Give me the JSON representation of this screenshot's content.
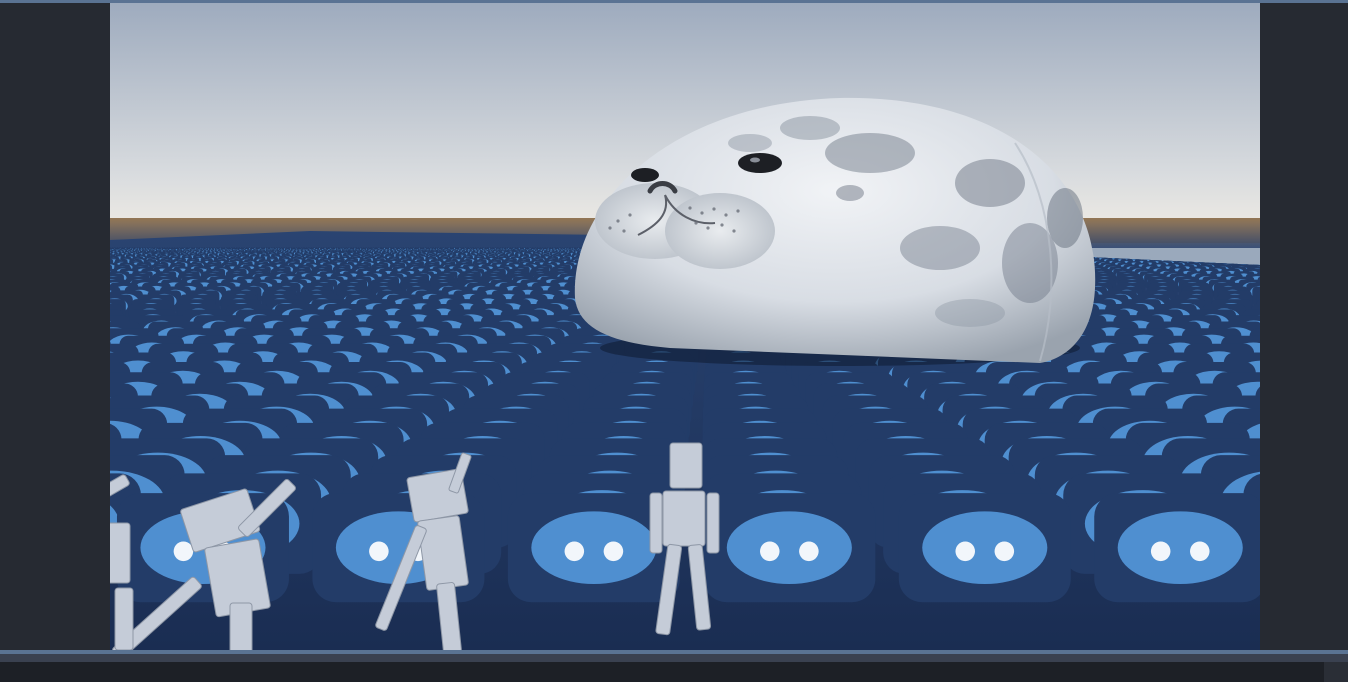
{
  "scene": {
    "sky_top": "#9eabbe",
    "sky_horizon": "#eceae6",
    "ground_horizon": "#7a5a38",
    "floor_tile": "#233c68",
    "floor_gap": "#16243f",
    "logo_color": "#4f8fd0",
    "mannequin_color": "#c5ccd8"
  },
  "objects": [
    {
      "name": "seal-plush",
      "kind": "plush seal model"
    },
    {
      "name": "godot-logo-floor",
      "kind": "tiled ground texture"
    },
    {
      "name": "mannequins",
      "kind": "humanoid figures",
      "count": 4
    }
  ]
}
